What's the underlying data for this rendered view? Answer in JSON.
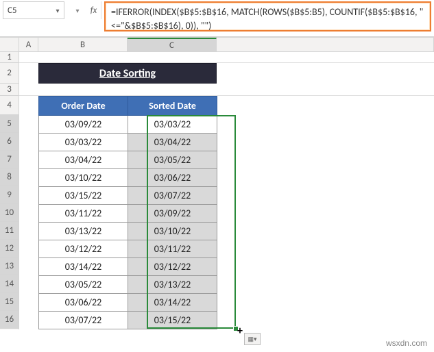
{
  "namebox": {
    "value": "C5",
    "dropdown_icon": "▾"
  },
  "fx_icon_label": "▾",
  "fx_label": "fx",
  "formula": "=IFERROR(INDEX($B$5:$B$16, MATCH(ROWS($B$5:B5), COUNTIF($B$5:$B$16, \"<=\"&$B$5:$B$16), 0)), \"\")",
  "columns": {
    "A": "A",
    "B": "B",
    "C": "C"
  },
  "rows": [
    "1",
    "2",
    "3",
    "4",
    "5",
    "6",
    "7",
    "8",
    "9",
    "10",
    "11",
    "12",
    "13",
    "14",
    "15",
    "16"
  ],
  "title": "Date Sorting",
  "headers": {
    "order": "Order Date",
    "sorted": "Sorted Date"
  },
  "data": [
    {
      "order": "03/09/22",
      "sorted": "03/03/22"
    },
    {
      "order": "03/03/22",
      "sorted": "03/04/22"
    },
    {
      "order": "03/04/22",
      "sorted": "03/05/22"
    },
    {
      "order": "03/10/22",
      "sorted": "03/06/22"
    },
    {
      "order": "03/15/22",
      "sorted": "03/07/22"
    },
    {
      "order": "03/11/22",
      "sorted": "03/09/22"
    },
    {
      "order": "03/13/22",
      "sorted": "03/10/22"
    },
    {
      "order": "03/12/22",
      "sorted": "03/11/22"
    },
    {
      "order": "03/14/22",
      "sorted": "03/12/22"
    },
    {
      "order": "03/05/22",
      "sorted": "03/13/22"
    },
    {
      "order": "03/06/22",
      "sorted": "03/14/22"
    },
    {
      "order": "03/07/22",
      "sorted": "03/15/22"
    }
  ],
  "watermark": "wsxdn.com"
}
